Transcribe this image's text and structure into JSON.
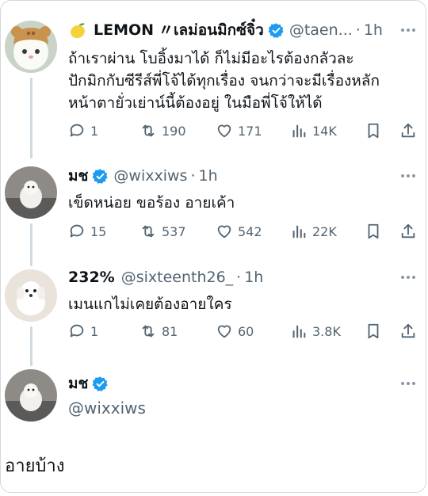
{
  "colors": {
    "accent": "#1d9bf0",
    "muted": "#536471",
    "thread": "#cfd9de",
    "gold": "#f0b90b"
  },
  "tweets": [
    {
      "name": "LEMON",
      "name_suffix": "〃เลม่อนมิกซ์จิ๋ว",
      "handle": "@taen...",
      "time": "1h",
      "text": "ถ้าเราผ่าน โบอิ้งมาได้ ก็ไม่มีอะไรต้องกลัวละ\nปักมิกกับซีรีส์พี่โจ้ได้ทุกเรื่อง จนกว่าจะมีเรื่องหลัก\nหน้าตายั่วเย่าน์นี้ต้องอยู่ ในมือพี่โจ้ให้ได้",
      "replies": "1",
      "reposts": "190",
      "likes": "171",
      "views": "14K"
    },
    {
      "name": "มช",
      "handle": "@wixxiws",
      "time": "1h",
      "text": "เข็ดหน่อย ขอร้อง อายเค้า",
      "replies": "15",
      "reposts": "537",
      "likes": "542",
      "views": "22K"
    },
    {
      "name": "232%",
      "handle": "@sixteenth26_",
      "time": "1h",
      "text": "เมนแกไม่เคยต้องอายใคร",
      "replies": "1",
      "reposts": "81",
      "likes": "60",
      "views": "3.8K"
    }
  ],
  "reply": {
    "name": "มช",
    "handle": "@wixxiws",
    "text": "อายบ้าง"
  },
  "icons": [
    "reply-icon",
    "repost-icon",
    "like-icon",
    "views-icon",
    "bookmark-icon",
    "share-icon",
    "verified-icon",
    "more-icon",
    "lemon-emoji-icon"
  ]
}
